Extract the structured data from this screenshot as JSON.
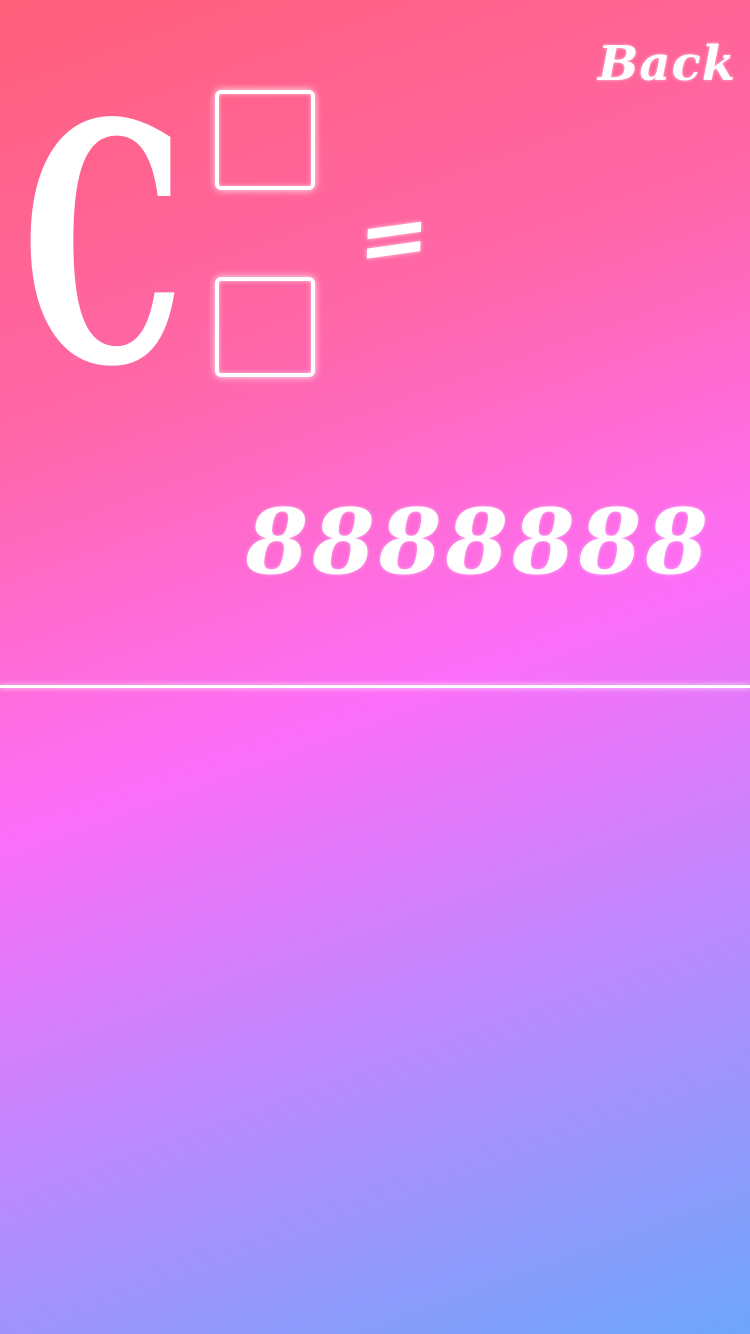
{
  "header": {
    "back_label": "Back"
  },
  "equation": {
    "symbol": "C",
    "equals_sign": "=",
    "top_slot_value": "",
    "bottom_slot_value": "",
    "result_display": "8888888"
  },
  "colors": {
    "gradient_top": "#ff5f79",
    "gradient_middle": "#fd6ef9",
    "gradient_bottom": "#6da6fa",
    "foreground": "#ffffff"
  }
}
